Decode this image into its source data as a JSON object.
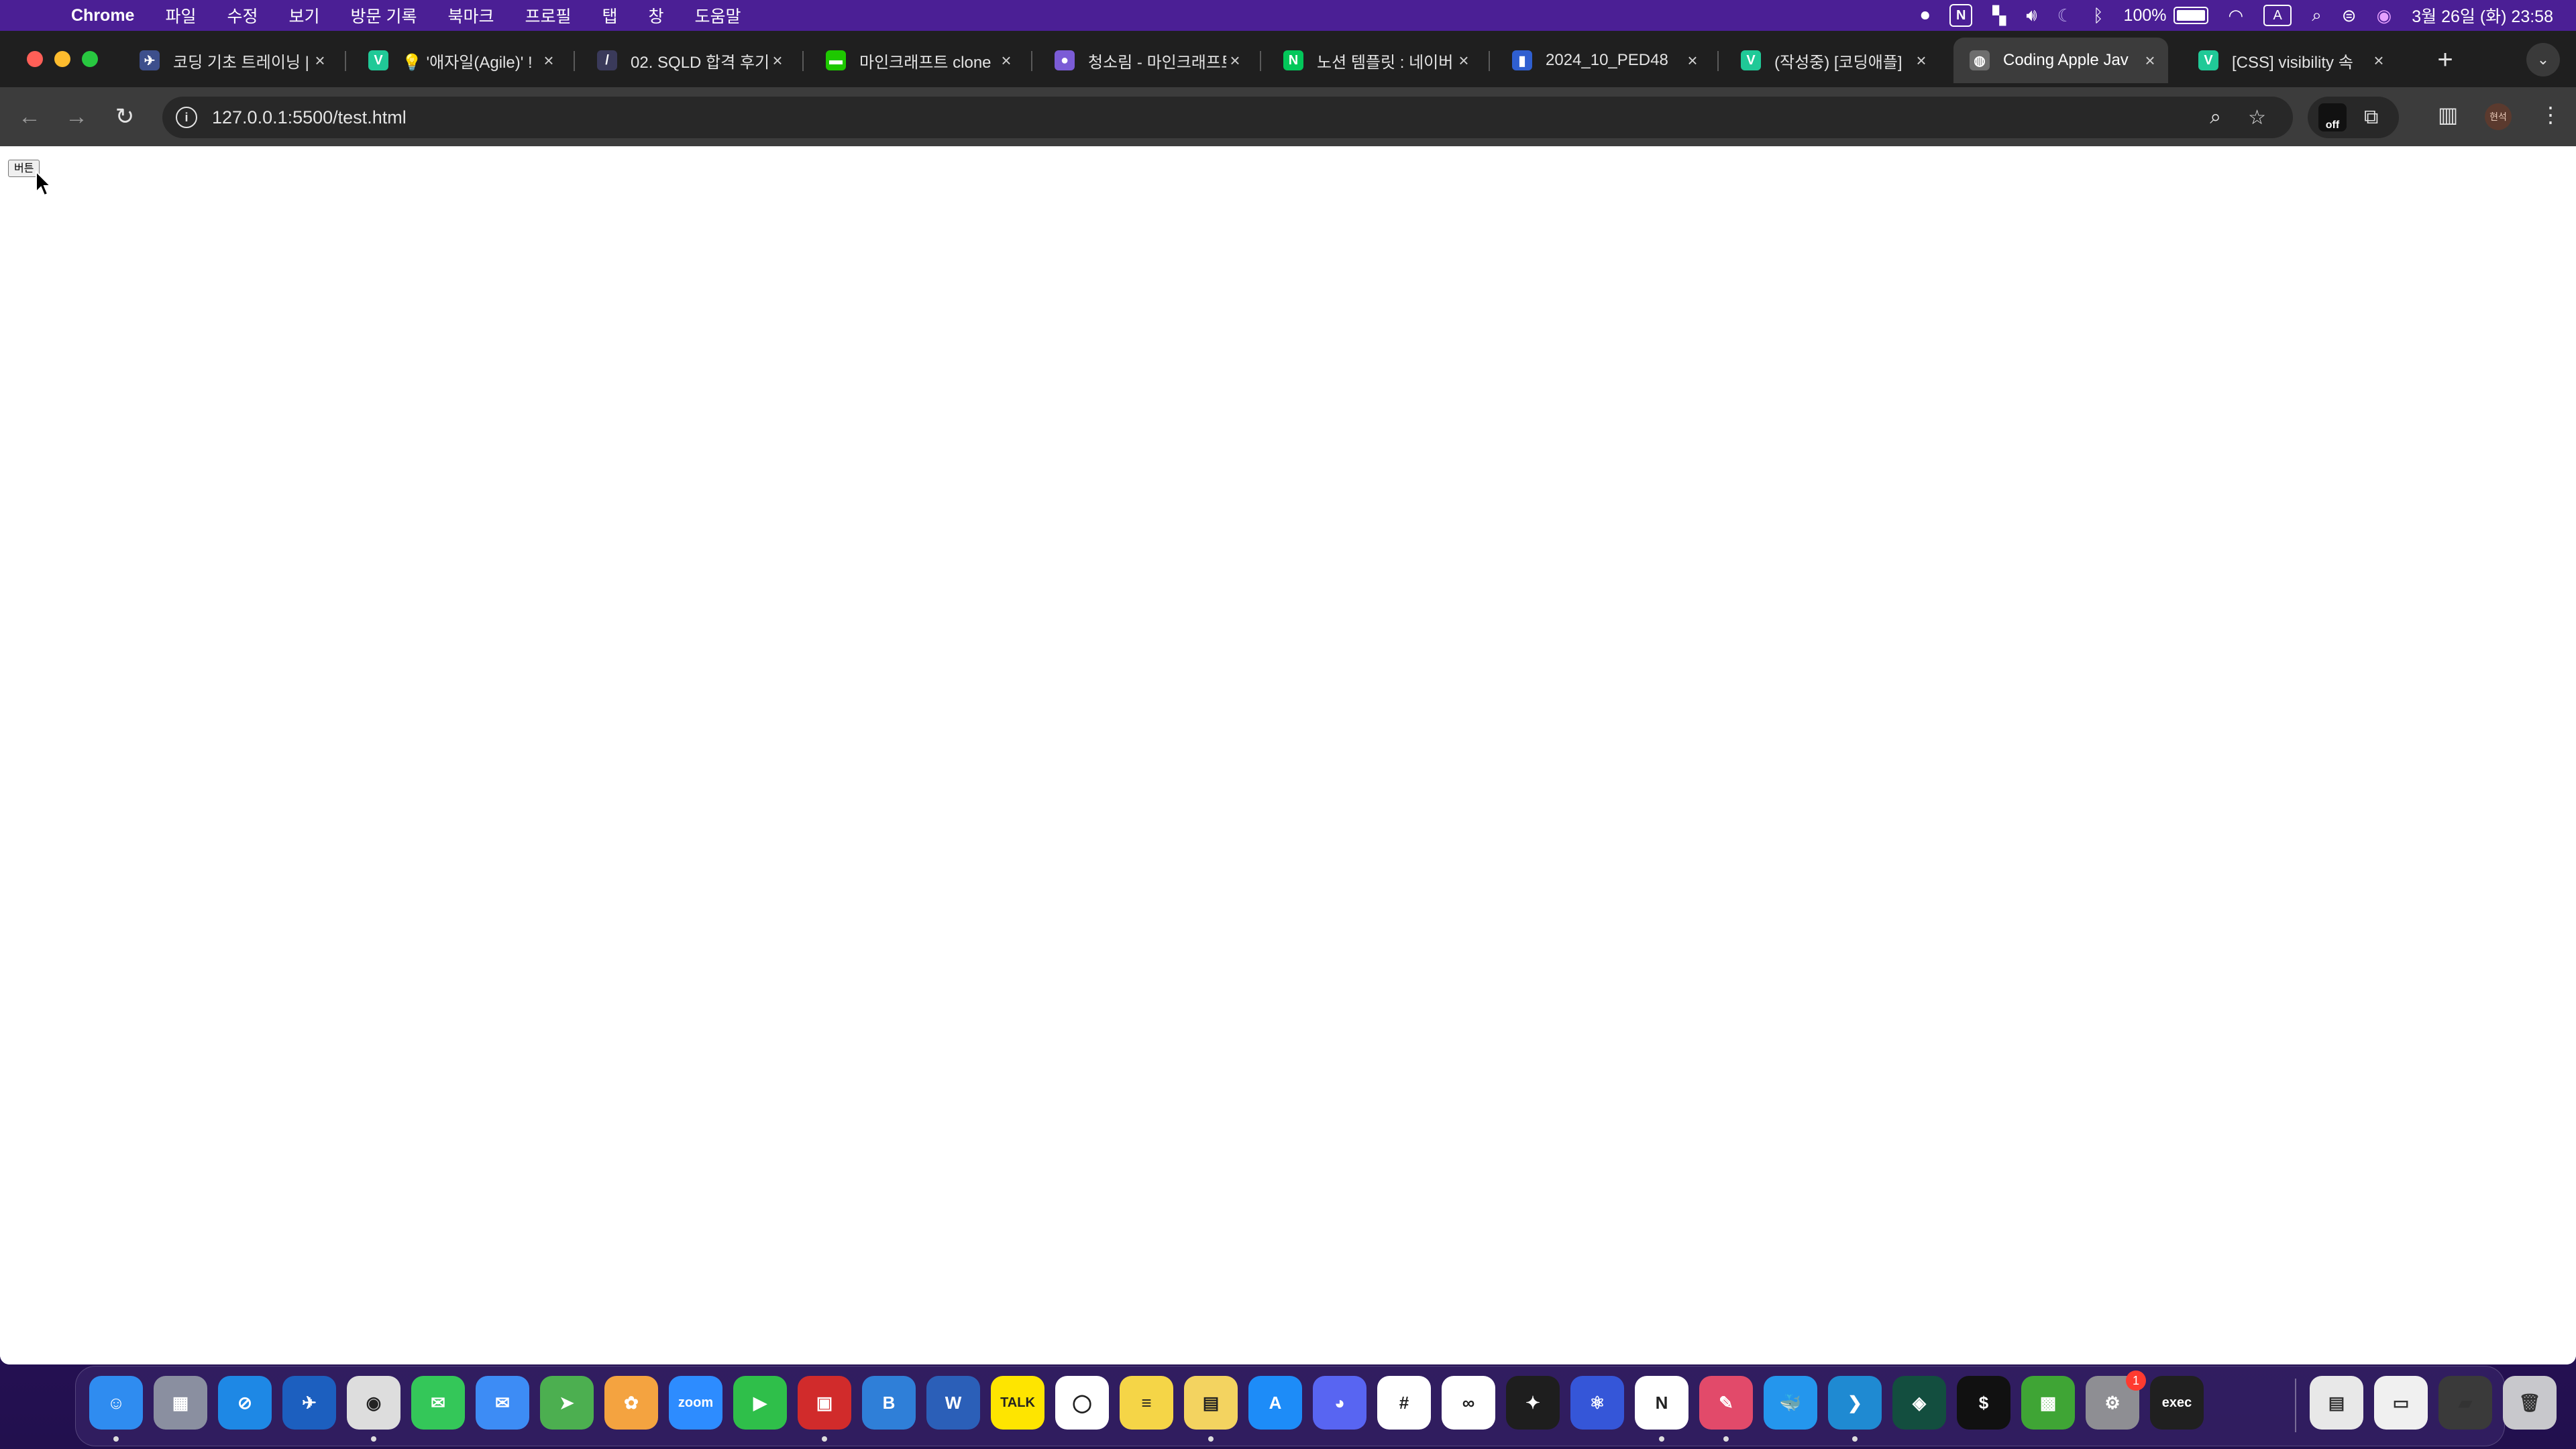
{
  "menubar": {
    "app_name": "Chrome",
    "items": [
      "파일",
      "수정",
      "보기",
      "방문 기록",
      "북마크",
      "프로필",
      "탭",
      "창",
      "도움말"
    ],
    "status": {
      "battery": "100%",
      "input_badge": "A",
      "notion_badge": "N",
      "datetime": "3월 26일 (화) 23:58"
    }
  },
  "tabs": [
    {
      "title": "코딩 기초 트레이닝 |",
      "favicon": "bird-icon",
      "color": "#3d4f8c",
      "active": false
    },
    {
      "title": "💡 '애자일(Agile)' !",
      "favicon": "v-icon",
      "color": "#20c997",
      "active": false
    },
    {
      "title": "02. SQLD 합격 후기",
      "favicon": "slash-icon",
      "color": "#3a3a5a",
      "active": false
    },
    {
      "title": "마인크래프트 clone",
      "favicon": "chat-icon",
      "color": "#1ec800",
      "active": false
    },
    {
      "title": "청소림 - 마인크래프트",
      "favicon": "circle-icon",
      "color": "#7b5cd6",
      "active": false
    },
    {
      "title": "노션 템플릿 : 네이버",
      "favicon": "n-icon",
      "color": "#03c75a",
      "active": false
    },
    {
      "title": "2024_10_PED48",
      "favicon": "bars-icon",
      "color": "#2f5fd0",
      "active": false
    },
    {
      "title": "(작성중) [코딩애플]",
      "favicon": "v-icon",
      "color": "#20c997",
      "active": false
    },
    {
      "title": "Coding Apple Jav",
      "favicon": "globe-icon",
      "color": "#6e6e6e",
      "active": true
    },
    {
      "title": "[CSS] visibility 속",
      "favicon": "v-icon",
      "color": "#20c997",
      "active": false
    }
  ],
  "toolbar": {
    "url": "127.0.0.1:5500/test.html",
    "ext_off_label": "off",
    "profile_label": "현석"
  },
  "page": {
    "button_label": "버튼"
  },
  "dock": {
    "apps": [
      {
        "name": "finder",
        "color": "#2f8cf0",
        "glyph": "☺",
        "running": true
      },
      {
        "name": "launchpad",
        "color": "#8a8fa0",
        "glyph": "▦",
        "running": false
      },
      {
        "name": "safari",
        "color": "#1e88e5",
        "glyph": "⊘",
        "running": false
      },
      {
        "name": "bluebird",
        "color": "#1c5fbf",
        "glyph": "✈",
        "running": false
      },
      {
        "name": "chrome",
        "color": "#dddddd",
        "glyph": "◉",
        "running": true
      },
      {
        "name": "messages",
        "color": "#34c759",
        "glyph": "✉",
        "running": false
      },
      {
        "name": "mail",
        "color": "#3d8cf5",
        "glyph": "✉",
        "running": false
      },
      {
        "name": "maps",
        "color": "#4caf50",
        "glyph": "➤",
        "running": false
      },
      {
        "name": "photos",
        "color": "#f4a340",
        "glyph": "✿",
        "running": false
      },
      {
        "name": "zoom",
        "color": "#2d8cff",
        "glyph": "zoom",
        "running": false
      },
      {
        "name": "facetime",
        "color": "#2fbf4a",
        "glyph": "▶",
        "running": false
      },
      {
        "name": "photobooth",
        "color": "#d12b2b",
        "glyph": "▣",
        "running": true
      },
      {
        "name": "books",
        "color": "#2f7fd8",
        "glyph": "B",
        "running": false
      },
      {
        "name": "word",
        "color": "#2b5fb8",
        "glyph": "W",
        "running": false
      },
      {
        "name": "kakaotalk",
        "color": "#fee500",
        "glyph": "TALK",
        "running": false
      },
      {
        "name": "naver-line",
        "color": "#ffffff",
        "glyph": "◯",
        "running": false
      },
      {
        "name": "notes",
        "color": "#f5d547",
        "glyph": "≡",
        "running": false
      },
      {
        "name": "stickies",
        "color": "#f3d360",
        "glyph": "▤",
        "running": true
      },
      {
        "name": "app-store",
        "color": "#1d8cf8",
        "glyph": "A",
        "running": false
      },
      {
        "name": "discord",
        "color": "#5865f2",
        "glyph": "◕",
        "running": false
      },
      {
        "name": "slack",
        "color": "#ffffff",
        "glyph": "#",
        "running": false
      },
      {
        "name": "link-app",
        "color": "#ffffff",
        "glyph": "∞",
        "running": false
      },
      {
        "name": "figma",
        "color": "#1e1e1e",
        "glyph": "✦",
        "running": false
      },
      {
        "name": "atom-app",
        "color": "#3556d8",
        "glyph": "⚛",
        "running": false
      },
      {
        "name": "notion",
        "color": "#ffffff",
        "glyph": "N",
        "running": true
      },
      {
        "name": "pencil-app",
        "color": "#e24a6a",
        "glyph": "✎",
        "running": true
      },
      {
        "name": "docker",
        "color": "#2496ed",
        "glyph": "🐳",
        "running": false
      },
      {
        "name": "vscode",
        "color": "#1f8ad2",
        "glyph": "❯",
        "running": true
      },
      {
        "name": "gitkraken",
        "color": "#134e3f",
        "glyph": "◈",
        "running": false
      },
      {
        "name": "terminal-green",
        "color": "#111111",
        "glyph": "$",
        "running": false
      },
      {
        "name": "minecraft",
        "color": "#3fa535",
        "glyph": "▩",
        "running": false
      },
      {
        "name": "system-settings",
        "color": "#8e8e93",
        "glyph": "⚙",
        "running": false,
        "badge": "1"
      },
      {
        "name": "terminal",
        "color": "#202020",
        "glyph": "exec",
        "running": false
      }
    ],
    "stack": [
      {
        "name": "document-stack",
        "color": "#e8e8e8",
        "glyph": "▤"
      },
      {
        "name": "screenshot-stack",
        "color": "#f0f0f0",
        "glyph": "▭"
      },
      {
        "name": "downloads-stack",
        "color": "#3a3a3a",
        "glyph": "▰"
      },
      {
        "name": "trash",
        "color": "#c8c8cc",
        "glyph": "🗑"
      }
    ]
  }
}
